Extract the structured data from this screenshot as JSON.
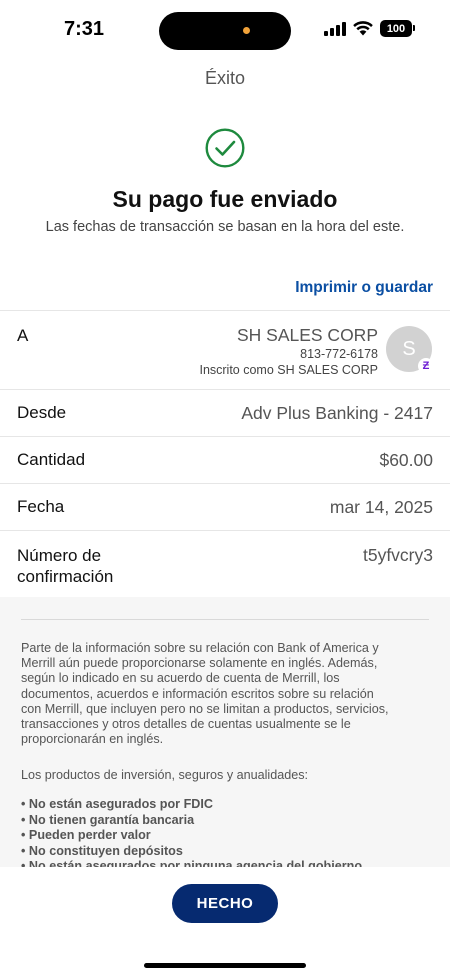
{
  "status_bar": {
    "time": "7:31",
    "battery": "100"
  },
  "screen": {
    "title": "Éxito"
  },
  "confirmation": {
    "headline": "Su pago fue enviado",
    "subline": "Las fechas de transacción se basan en la hora del este.",
    "print_label": "Imprimir o guardar",
    "icon": "check-circle-icon",
    "accent_color": "#1e8a3e"
  },
  "details": {
    "to": {
      "label": "A",
      "name": "SH SALES CORP",
      "phone": "813-772-6178",
      "enrolled": "Inscrito como SH SALES CORP",
      "avatar_initial": "S",
      "badge": "Ƶ"
    },
    "from": {
      "label": "Desde",
      "value": "Adv Plus Banking - 2417"
    },
    "amount": {
      "label": "Cantidad",
      "value": "$60.00"
    },
    "date": {
      "label": "Fecha",
      "value": "mar 14, 2025"
    },
    "confirmation_number": {
      "label": "Número de confirmación",
      "value": "t5yfvcry3"
    }
  },
  "disclosure": {
    "paragraph_lines": [
      "Parte de la información sobre su relación con Bank of America y",
      "Merrill aún puede proporcionarse solamente en inglés. Además,",
      "según lo indicado en su acuerdo de cuenta de Merrill, los",
      "documentos, acuerdos e información escritos sobre su relación",
      "con Merrill, que incluyen pero no se limitan a productos, servicios,",
      "transacciones y otros detalles de cuentas usualmente se le",
      "proporcionarán en inglés."
    ],
    "intro": "Los productos de inversión, seguros y anualidades:",
    "bullets": [
      "No están asegurados por FDIC",
      "No tienen garantía bancaria",
      "Pueden perder valor",
      "No constituyen depósitos",
      "No están asegurados por ninguna agencia del gobierno"
    ]
  },
  "footer": {
    "done_label": "HECHO",
    "button_color": "#062a70"
  }
}
